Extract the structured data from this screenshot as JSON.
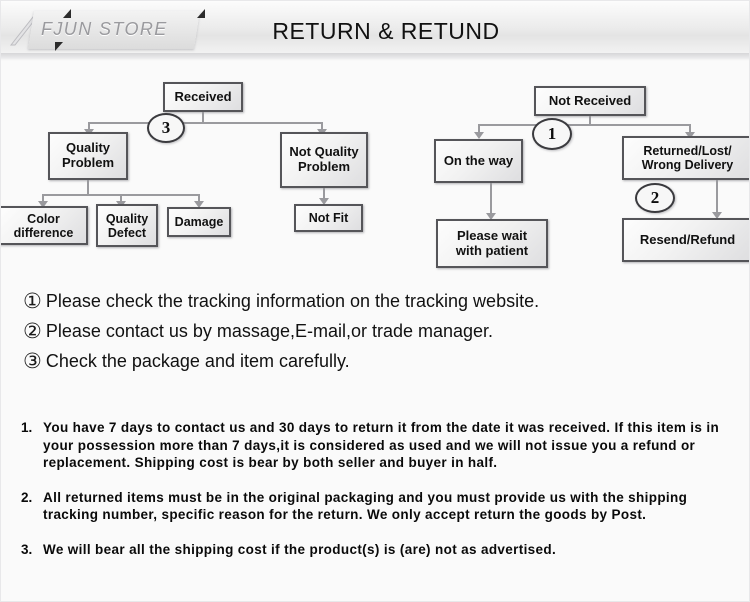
{
  "header": {
    "logo_text": "FJUN STORE",
    "title": "RETURN & RETUND"
  },
  "flowchart_left": {
    "nodes": [
      {
        "id": "received",
        "label": "Received"
      },
      {
        "id": "quality-problem",
        "label": "Quality\nProblem"
      },
      {
        "id": "not-quality-problem",
        "label": "Not Quality\nProblem"
      },
      {
        "id": "color-difference",
        "label": "Color\ndifference"
      },
      {
        "id": "quality-defect",
        "label": "Quality\nDefect"
      },
      {
        "id": "damage",
        "label": "Damage"
      },
      {
        "id": "not-fit",
        "label": "Not Fit"
      }
    ],
    "callout": "3"
  },
  "flowchart_right": {
    "nodes": [
      {
        "id": "not-received",
        "label": "Not  Received"
      },
      {
        "id": "on-the-way",
        "label": "On the way"
      },
      {
        "id": "returned-lost-wrong-delivery",
        "label": "Returned/Lost/\nWrong Delivery"
      },
      {
        "id": "please-wait",
        "label": "Please wait\nwith patient"
      },
      {
        "id": "resend-refund",
        "label": "Resend/Refund"
      }
    ],
    "callout_1": "1",
    "callout_2": "2"
  },
  "notes": [
    {
      "mark": "①",
      "text": "Please check the tracking information on the tracking website."
    },
    {
      "mark": "②",
      "text": "Please contact us by  massage,E-mail,or trade manager."
    },
    {
      "mark": "③",
      "text": "Check the package and item carefully."
    }
  ],
  "policy": [
    {
      "num": "1.",
      "text": "You have 7 days to contact us and 30 days to return it from the date it was received. If this item is in your possession more than 7 days,it is considered as used and we will not issue you a refund or replacement. Shipping cost is bear by both seller and buyer in half."
    },
    {
      "num": "2.",
      "text": "All returned items must be in the original packaging and you must provide us with the shipping tracking number, specific reason for the return. We only accept return the goods by Post."
    },
    {
      "num": "3.",
      "text": "We will bear all the shipping cost if the product(s) is (are) not as advertised."
    }
  ],
  "colors": {
    "page_background": "#fafafa",
    "node_border": "#555559",
    "connector": "#9a9a9e",
    "logo_text": "#9a9a9e",
    "text": "#111111"
  }
}
